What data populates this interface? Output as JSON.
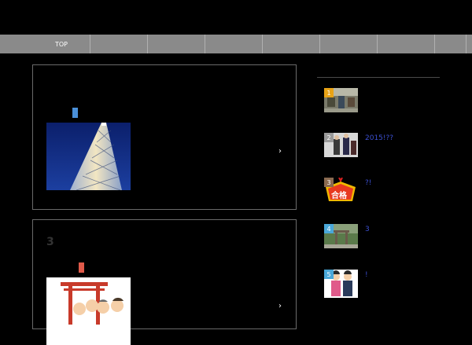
{
  "nav": {
    "items": [
      "TOP",
      "",
      "",
      "",
      "",
      "",
      "",
      ""
    ]
  },
  "posts": [
    {
      "title": "",
      "tag_color": "#4a90d9",
      "arrow": "›",
      "thumb": "skytree"
    },
    {
      "title": "3",
      "tag_color": "#e05a4a",
      "arrow": "›",
      "thumb": "shrine-family"
    }
  ],
  "ranking": [
    {
      "num": "1",
      "badge_color": "#e8a317",
      "title": "",
      "thumb": "market"
    },
    {
      "num": "2",
      "badge_color": "#9a9a9a",
      "title": "2015!??",
      "thumb": "people"
    },
    {
      "num": "3",
      "badge_color": "#8a6a50",
      "title": "?!",
      "thumb": "goukaku-sign",
      "thumb_text": "合格"
    },
    {
      "num": "4",
      "badge_color": "#4aa8d9",
      "title": "3",
      "thumb": "forest-gate"
    },
    {
      "num": "5",
      "badge_color": "#4aa8d9",
      "title": "!",
      "thumb": "kimono-family"
    }
  ]
}
